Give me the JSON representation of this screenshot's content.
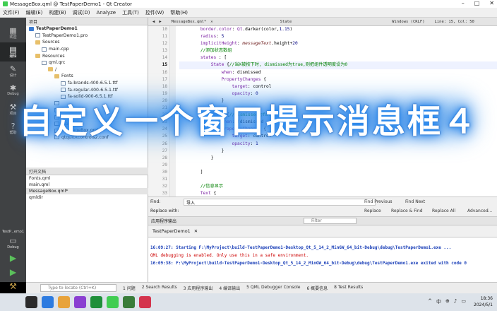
{
  "window": {
    "title": "MessageBox.qml @ TestPaperDemo1 - Qt Creator"
  },
  "menu": [
    "文件(F)",
    "编辑(E)",
    "构建(B)",
    "调试(D)",
    "Analyze",
    "工具(T)",
    "控件(W)",
    "帮助(H)"
  ],
  "modes": [
    {
      "label": "欢迎",
      "icon": "grid-icon"
    },
    {
      "label": "编辑",
      "icon": "edit-icon"
    },
    {
      "label": "设计",
      "icon": "pencil-icon"
    },
    {
      "label": "Debug",
      "icon": "bug-icon"
    },
    {
      "label": "项目",
      "icon": "wrench-icon"
    },
    {
      "label": "帮助",
      "icon": "help-icon"
    }
  ],
  "kit": {
    "name": "TestP...emo1",
    "mode": "Debug"
  },
  "projects_pane": {
    "title": "项目"
  },
  "tree": [
    {
      "label": "TestPaperDemo1",
      "indent": 0,
      "kind": "proj"
    },
    {
      "label": "TestPaperDemo1.pro",
      "indent": 1,
      "kind": "file"
    },
    {
      "label": "Sources",
      "indent": 1,
      "kind": "folder"
    },
    {
      "label": "main.cpp",
      "indent": 2,
      "kind": "file"
    },
    {
      "label": "Resources",
      "indent": 1,
      "kind": "folder"
    },
    {
      "label": "qml.qrc",
      "indent": 2,
      "kind": "file"
    },
    {
      "label": "/",
      "indent": 3,
      "kind": "folder"
    },
    {
      "label": "Fonts",
      "indent": 4,
      "kind": "folder"
    },
    {
      "label": "fa-brands-400-6.5.1.ttf",
      "indent": 5,
      "kind": "file"
    },
    {
      "label": "fa-regular-400-6.5.1.ttf",
      "indent": 5,
      "kind": "file"
    },
    {
      "label": "fa-solid-900-6.5.1.ttf",
      "indent": 5,
      "kind": "file"
    },
    {
      "label": "",
      "indent": 4,
      "kind": "file"
    },
    {
      "label": "Fonts.qml",
      "indent": 4,
      "kind": "file"
    },
    {
      "label": "",
      "indent": 4,
      "kind": "file"
    },
    {
      "label": "main.qml",
      "indent": 4,
      "kind": "file"
    },
    {
      "label": "MessageBox.qml",
      "indent": 4,
      "kind": "file"
    },
    {
      "label": "qtquickcontrols2.conf",
      "indent": 4,
      "kind": "file"
    }
  ],
  "open_docs": {
    "title": "打开文档",
    "items": [
      "Fonts.qml",
      "main.qml",
      "MessageBox.qml*",
      "qmldir"
    ]
  },
  "editor": {
    "file_tab": "MessageBox.qml*",
    "symbol": "State",
    "encoding": "Windows (CRLF)",
    "position": "Line: 15, Col: 50"
  },
  "code_lines": [
    {
      "n": "10",
      "html": "        <span class=\"c-prop\">border.color</span>: <span class=\"c-type\">Qt</span>.darker(color,<span class=\"c-num\">1.15</span>)"
    },
    {
      "n": "11",
      "html": "        <span class=\"c-prop\">radius</span>: <span class=\"c-num\">5</span>"
    },
    {
      "n": "12",
      "html": "        <span class=\"c-prop\">implicitHeight</span>: <span class=\"c-it\">messageText</span>.height+<span class=\"c-num\">20</span>"
    },
    {
      "n": "13",
      "html": "        <span class=\"c-com\">//添加状态数组</span>"
    },
    {
      "n": "14",
      "html": "        <span class=\"c-prop\">states</span> : ["
    },
    {
      "n": "15",
      "html": "            <span class=\"c-type\">State</span> {<span class=\"c-com\">//当X被按下时, dismissed为true,则把组件透明度设为0</span>"
    },
    {
      "n": "16",
      "html": "                <span class=\"c-prop\">when</span>: dismissed"
    },
    {
      "n": "17",
      "html": "                <span class=\"c-type\">PropertyChanges</span> {"
    },
    {
      "n": "18",
      "html": "                    <span class=\"c-prop\">target</span>: control"
    },
    {
      "n": "19",
      "html": "                    <span class=\"c-prop\">opacity</span>: <span class=\"c-num\">0</span>"
    },
    {
      "n": "20",
      "html": "                }"
    },
    {
      "n": "21",
      "html": "            },"
    },
    {
      "n": "22",
      "html": "            <span class=\"c-type\">State</span> {<span class=\"c-com\">//dismissed为false</span>"
    },
    {
      "n": "23",
      "html": "                <span class=\"c-prop\">when</span>: !dismissed"
    },
    {
      "n": "24",
      "html": "                <span class=\"c-type\">PropertyChanges</span> {"
    },
    {
      "n": "25",
      "html": "                    <span class=\"c-prop\">target</span>: control"
    },
    {
      "n": "26",
      "html": "                    <span class=\"c-prop\">opacity</span>: <span class=\"c-num\">1</span>"
    },
    {
      "n": "27",
      "html": "                }"
    },
    {
      "n": "28",
      "html": "            }"
    },
    {
      "n": "29",
      "html": ""
    },
    {
      "n": "30",
      "html": "        ]"
    },
    {
      "n": "31",
      "html": ""
    },
    {
      "n": "32",
      "html": "        <span class=\"c-com\">//信息显示</span>"
    },
    {
      "n": "33",
      "html": "        <span class=\"c-type\">Text</span> {"
    },
    {
      "n": "34",
      "html": "            <span class=\"c-prop\">id</span>:messageText"
    }
  ],
  "current_line": "15",
  "find": {
    "find_label": "Find:",
    "find_value": "导入",
    "replace_label": "Replace with:",
    "find_previous": "Find Previous",
    "find_next": "Find Next",
    "replace": "Replace",
    "replace_find": "Replace & Find",
    "replace_all": "Replace All",
    "advanced": "Advanced..."
  },
  "output": {
    "pane_title": "应用程序输出",
    "filter_placeholder": "Filter",
    "tab": "TestPaperDemo1",
    "lines": [
      {
        "cls": "o-blue",
        "text": "16:09:27: Starting F:\\MyProject\\build-TestPaperDemo1-Desktop_Qt_5_14_2_MinGW_64_bit-Debug\\debug\\TestPaperDemo1.exe ..."
      },
      {
        "cls": "o-red",
        "text": "QML debugging is enabled. Only use this in a safe environment."
      },
      {
        "cls": "o-blue",
        "text": "16:09:38: F:\\MyProject\\build-TestPaperDemo1-Desktop_Qt_5_14_2_MinGW_64_bit-Debug\\debug\\TestPaperDemo1.exe exited with code 0"
      }
    ]
  },
  "statusbar": {
    "locate_placeholder": "Type to locate (Ctrl+K)",
    "tabs": [
      "1 问题",
      "2 Search Results",
      "3 应用程序输出",
      "4 编译输出",
      "5 QML Debugger Console",
      "6 概要信息",
      "8 Test Results"
    ]
  },
  "taskbar": {
    "time": "18:36",
    "date": "2024/5/1",
    "tray": [
      "^",
      "中",
      "⊕",
      "♪",
      "▭"
    ],
    "apps": [
      "#2b2b2b",
      "#2d7be0",
      "#e8a33b",
      "#8a3fd1",
      "#1f8f3a",
      "#41cd52",
      "#3a7d3a",
      "#d4344d"
    ]
  },
  "banner": {
    "text": "自定义一个窗口提示消息框４"
  }
}
